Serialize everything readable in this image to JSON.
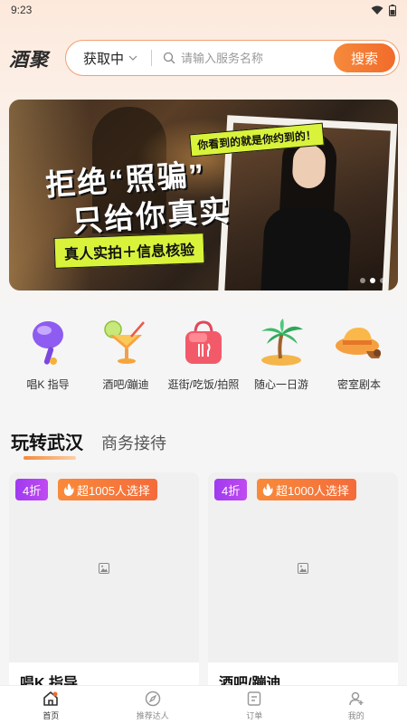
{
  "status": {
    "time": "9:23"
  },
  "header": {
    "logo": "酒聚",
    "location": "获取中",
    "search_placeholder": "请输入服务名称",
    "search_button": "搜索"
  },
  "banner": {
    "tag": "你看到的就是你约到的！",
    "line1": "拒绝“照骗”",
    "line2": "只给你真实",
    "strip": "真人实拍＋信息核验"
  },
  "categories": [
    {
      "label": "唱K 指导",
      "icon": "microphone-icon"
    },
    {
      "label": "酒吧/蹦迪",
      "icon": "cocktail-icon"
    },
    {
      "label": "逛街/吃饭/拍照",
      "icon": "shopping-bag-icon"
    },
    {
      "label": "随心一日游",
      "icon": "palm-island-icon"
    },
    {
      "label": "密室剧本",
      "icon": "detective-hat-icon"
    }
  ],
  "tabs": {
    "active": "玩转武汉",
    "other": "商务接待"
  },
  "cards": [
    {
      "discount": "4折",
      "hot": "超1005人选择",
      "title": "唱K 指导"
    },
    {
      "discount": "4折",
      "hot": "超1000人选择",
      "title": "酒吧/蹦迪"
    }
  ],
  "nav": [
    {
      "label": "首页",
      "icon": "home-icon"
    },
    {
      "label": "推荐达人",
      "icon": "compass-icon"
    },
    {
      "label": "订单",
      "icon": "order-icon"
    },
    {
      "label": "我的",
      "icon": "profile-icon"
    }
  ],
  "colors": {
    "accent": "#f26b2a",
    "discount": "#b040f0",
    "tag": "#d9f33b"
  }
}
